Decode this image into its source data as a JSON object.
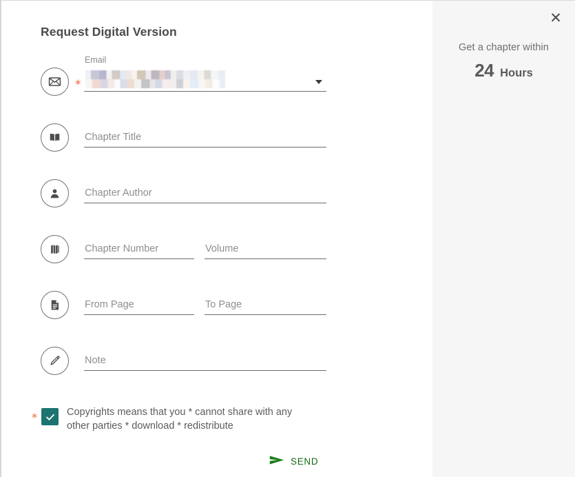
{
  "form": {
    "title": "Request Digital Version",
    "fields": [
      {
        "key": "email",
        "icon": "envelope-icon",
        "label": "Email",
        "value": "",
        "placeholder": "",
        "required": true,
        "redacted": true,
        "dropdown": true,
        "layout": "full"
      },
      {
        "key": "chapter_title",
        "icon": "open-book-icon",
        "label": "",
        "value": "",
        "placeholder": "Chapter Title",
        "required": false,
        "redacted": false,
        "dropdown": false,
        "layout": "full"
      },
      {
        "key": "chapter_author",
        "icon": "person-icon",
        "label": "",
        "value": "",
        "placeholder": "Chapter Author",
        "required": false,
        "redacted": false,
        "dropdown": false,
        "layout": "full"
      },
      {
        "key": "chapter_number",
        "icon": "books-stack-icon",
        "label": "",
        "value": "",
        "placeholder": "Chapter Number",
        "second_placeholder": "Volume",
        "second_key": "volume",
        "required": false,
        "redacted": false,
        "dropdown": false,
        "layout": "split"
      },
      {
        "key": "from_page",
        "icon": "document-icon",
        "label": "",
        "value": "",
        "placeholder": "From Page",
        "second_placeholder": "To Page",
        "second_key": "to_page",
        "required": false,
        "redacted": false,
        "dropdown": false,
        "layout": "split"
      },
      {
        "key": "note",
        "icon": "pencil-icon",
        "label": "",
        "value": "",
        "placeholder": "Note",
        "required": false,
        "redacted": false,
        "dropdown": false,
        "layout": "full"
      }
    ],
    "consent": {
      "required_marker": "*",
      "checked": true,
      "text": "Copyrights means that you * cannot share with any other parties * download * redistribute"
    },
    "submit": {
      "label": "SEND",
      "icon": "send-arrow-icon"
    }
  },
  "side_panel": {
    "close_label": "✕",
    "promo_line1": "Get a chapter within",
    "promo_number": "24",
    "promo_unit": "Hours"
  },
  "colors": {
    "accent_teal": "#1b7470",
    "send_green": "#136b13",
    "required_orange": "#f4613b",
    "text_gray": "#5c5c5c",
    "placeholder_gray": "#8e8e8e",
    "panel_bg": "#f6f6f6"
  }
}
